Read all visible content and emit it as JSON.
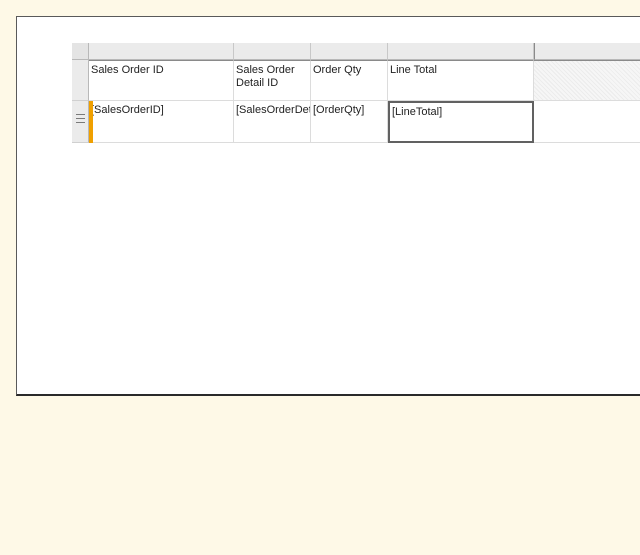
{
  "tablix": {
    "headers": [
      "Sales Order ID",
      "Sales Order\nDetail ID",
      "Order Qty",
      "Line Total"
    ],
    "detail_fields": [
      "[SalesOrderID]",
      "[SalesOrderDetailID]",
      "[OrderQty]",
      "[LineTotal]"
    ],
    "selected_cell": "[LineTotal]"
  },
  "colors": {
    "background": "#fef9e7",
    "canvas": "#ffffff",
    "handle": "#ebebeb",
    "focus_bar": "#f0a000",
    "selection_border": "#616161"
  },
  "icons": {
    "row_marker": "details-group-icon"
  }
}
